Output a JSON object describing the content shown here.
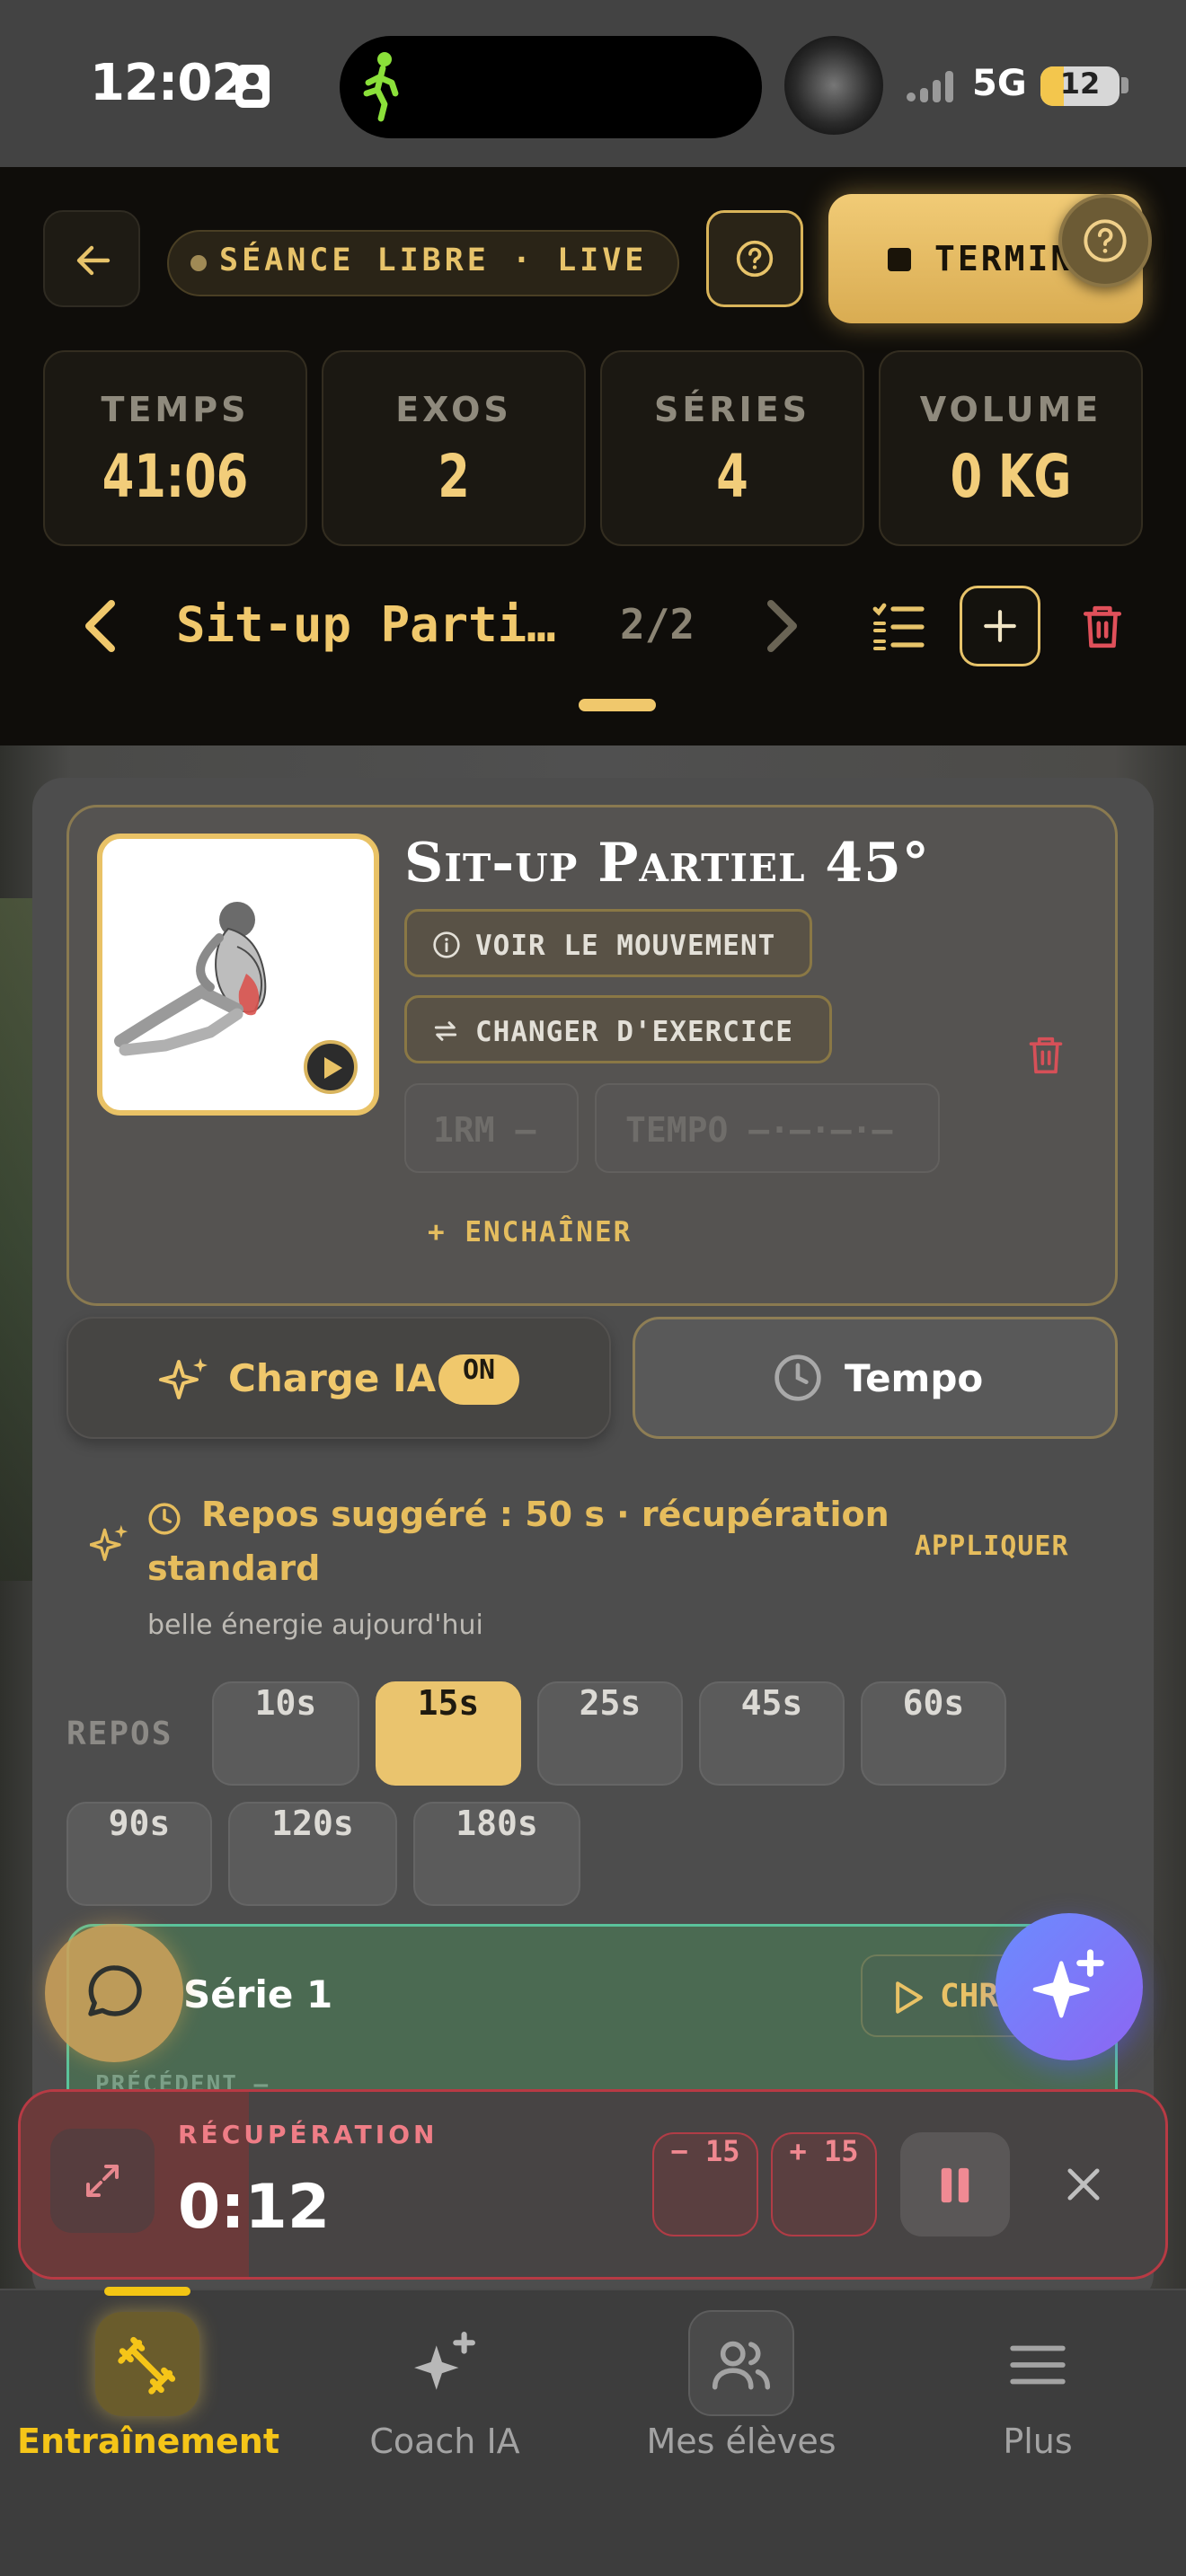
{
  "status_bar": {
    "time": "12:02",
    "network": "5G",
    "battery": "12"
  },
  "header": {
    "live_label": "SÉANCE LIBRE · LIVE",
    "finish_label": "TERMINER",
    "stats": [
      {
        "label": "TEMPS",
        "value": "41:06"
      },
      {
        "label": "EXOS",
        "value": "2"
      },
      {
        "label": "SÉRIES",
        "value": "4"
      },
      {
        "label": "VOLUME",
        "value": "0 KG"
      }
    ],
    "exercise_title": "Sit-up Parti…",
    "exercise_counter": "2/2"
  },
  "exercise": {
    "name": "Sit-up Partiel 45°",
    "view_movement": "VOIR LE MOUVEMENT",
    "change_exercise": "CHANGER D'EXERCICE",
    "one_rm": "1RM —",
    "tempo_placeholder": "TEMPO —·—·—·—",
    "chain_label": "+ ENCHAÎNER"
  },
  "toggles": {
    "ia_label": "Charge IA",
    "ia_state": "ON",
    "tempo_label": "Tempo"
  },
  "suggestion": {
    "line1": "Repos suggéré : 50 s · récupération",
    "line2": "standard",
    "subtitle": "belle énergie aujourd'hui",
    "apply_label": "APPLIQUER"
  },
  "rest": {
    "label": "REPOS",
    "options": [
      "10s",
      "15s",
      "25s",
      "45s",
      "60s",
      "90s",
      "120s",
      "180s"
    ],
    "selected": "15s"
  },
  "series": {
    "title": "Série 1",
    "start_label": "CHRONO",
    "previous_label": "PRÉCÉDENT —"
  },
  "recovery": {
    "label": "RÉCUPÉRATION",
    "time": "0:12",
    "minus_label": "− 15",
    "plus_label": "+ 15",
    "progress": 0.2
  },
  "nav": {
    "items": [
      {
        "label": "Entraînement",
        "icon": "dumbbell-icon",
        "active": true
      },
      {
        "label": "Coach IA",
        "icon": "sparkle-icon",
        "active": false
      },
      {
        "label": "Mes élèves",
        "icon": "users-icon",
        "active": false
      },
      {
        "label": "Plus",
        "icon": "menu-icon",
        "active": false
      }
    ]
  },
  "colors": {
    "accent_gold": "#f0c86c",
    "nav_active": "#f5c518",
    "recovery_red": "#b83a44",
    "series_green": "#5ac39b"
  }
}
